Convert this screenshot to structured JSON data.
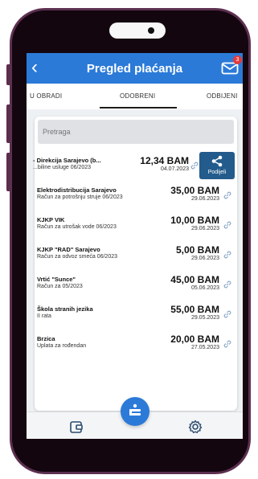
{
  "header": {
    "title": "Pregled plaćanja",
    "badge_count": "3",
    "back_icon": "chevron-left-icon",
    "mail_icon": "mail-icon"
  },
  "tabs": [
    {
      "label": "U OBRADI",
      "active": false
    },
    {
      "label": "ODOBRENI",
      "active": true
    },
    {
      "label": "ODBIJENI",
      "active": false
    }
  ],
  "search": {
    "placeholder": "Pretraga"
  },
  "payments": [
    {
      "name": "- Direkcija Sarajevo (b...",
      "description": "...biline usluge 06/2023",
      "amount": "12,34 BAM",
      "date": "04.07.2023",
      "swiped": true
    },
    {
      "name": "Elektrodistribucija Sarajevo",
      "description": "Račun za potrošnju struje 06/2023",
      "amount": "35,00 BAM",
      "date": "29.06.2023"
    },
    {
      "name": "KJKP VIK",
      "description": "Račun za utrošak vode 06/2023",
      "amount": "10,00 BAM",
      "date": "29.06.2023"
    },
    {
      "name": "KJKP \"RAD\"  Sarajevo",
      "description": "Račun za odvoz smeća 06/2023",
      "amount": "5,00 BAM",
      "date": "29.06.2023"
    },
    {
      "name": "Vrtić \"Sunce\"",
      "description": "Račun za 05/2023",
      "amount": "45,00 BAM",
      "date": "05.06.2023"
    },
    {
      "name": "Škola stranih jezika",
      "description": "II rata",
      "amount": "55,00 BAM",
      "date": "29.05.2023"
    },
    {
      "name": "Brzica",
      "description": "Uplata za rođendan",
      "amount": "20,00 BAM",
      "date": "27.05.2023"
    }
  ],
  "share": {
    "label": "Podijeli",
    "icon": "share-icon"
  },
  "bottom_nav": {
    "left_icon": "wallet-icon",
    "center_icon": "bank-logo-icon",
    "right_icon": "settings-gear-icon"
  },
  "colors": {
    "primary": "#2b7ad8",
    "share_button": "#235b8c",
    "badge": "#e23b3b",
    "phone_frame": "#14060f"
  }
}
